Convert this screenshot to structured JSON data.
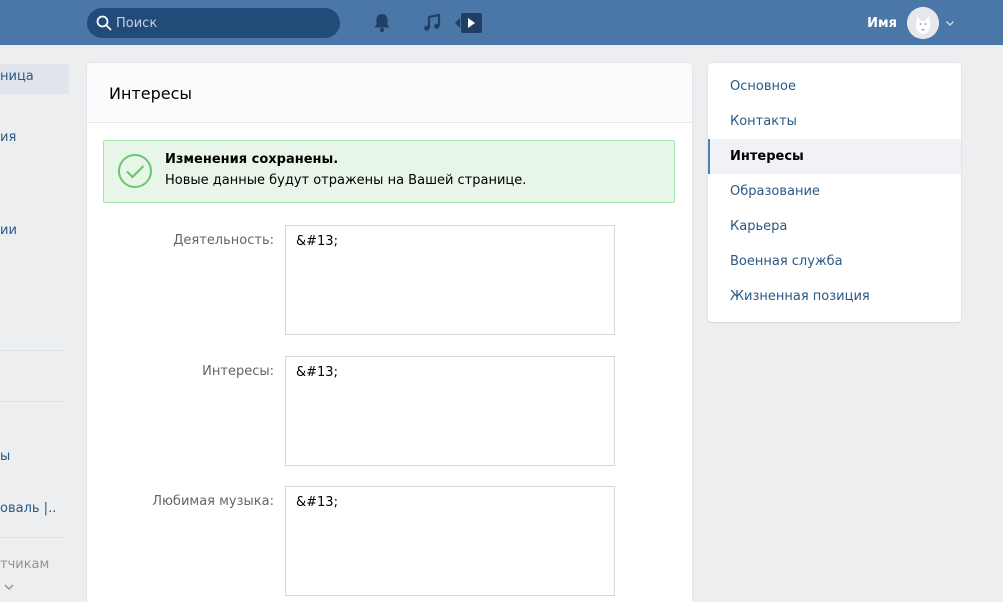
{
  "header": {
    "search_placeholder": "Поиск",
    "user_name": "Имя",
    "icons": [
      "search-icon",
      "bell-icon",
      "music-icon",
      "video-icon",
      "chevron-down-icon"
    ]
  },
  "left_nav": {
    "items": [
      "ница",
      "ия",
      "ии",
      "ы",
      "оваль |..",
      "тчикам"
    ]
  },
  "card": {
    "title": "Интересы",
    "success": {
      "title": "Изменения сохранены.",
      "text": "Новые данные будут отражены на Вашей странице."
    },
    "fields": [
      {
        "label": "Деятельность:",
        "value": "&#13;"
      },
      {
        "label": "Интересы:",
        "value": "&#13;"
      },
      {
        "label": "Любимая музыка:",
        "value": "&#13;"
      }
    ]
  },
  "right_menu": {
    "items": [
      "Основное",
      "Контакты",
      "Интересы",
      "Образование",
      "Карьера",
      "Военная служба",
      "Жизненная позиция"
    ],
    "active": "Интересы"
  },
  "colors": {
    "header_bg": "#4a76a8",
    "link": "#2a5885",
    "success_bg": "#e8f6e9",
    "success_border": "#a8e4af"
  }
}
